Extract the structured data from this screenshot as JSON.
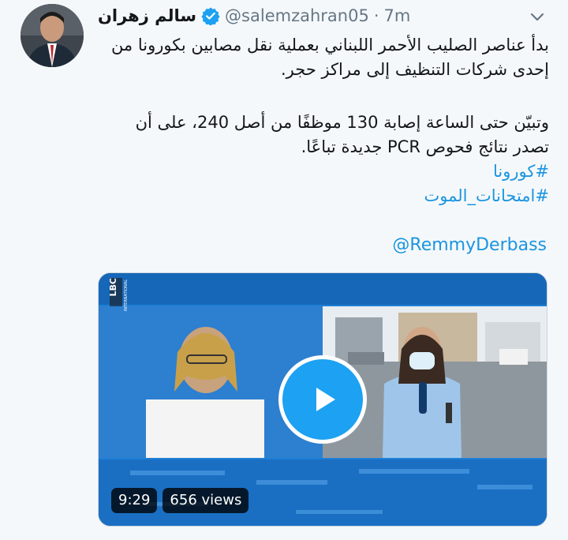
{
  "tweet": {
    "author": {
      "display_name": "سالم زهران",
      "handle": "@salemzahran05",
      "verified": true
    },
    "separator": "·",
    "time": "7m",
    "text_lines": [
      "بدأ عناصر الصليب الأحمر اللبناني بعملية نقل مصابين بكورونا من",
      "إحدى شركات التنظيف إلى مراكز حجر.",
      "وتبيّن حتى الساعة إصابة 130 موظفًا من أصل 240، على أن",
      "تصدر نتائج فحوص PCR جديدة تباعًا."
    ],
    "hashtags": [
      "#كورونا",
      "#امتحانات_الموت"
    ],
    "mention": "@RemmyDerbass",
    "media": {
      "channel_logo": "LBC",
      "channel_sub": "INTERNATIONAL",
      "duration": "9:29",
      "views": "656 views"
    }
  },
  "colors": {
    "link": "#1b95e0",
    "verified": "#1da1f2",
    "secondary_text": "#657786"
  },
  "icons": [
    "verified-badge-icon",
    "chevron-down-icon",
    "play-icon"
  ]
}
